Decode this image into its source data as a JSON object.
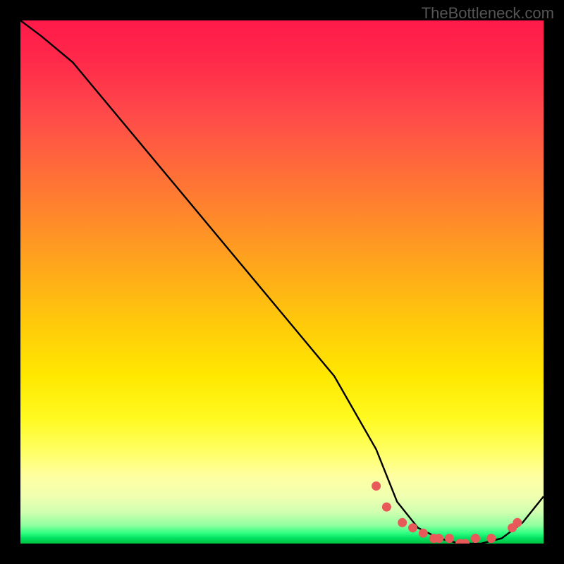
{
  "watermark": "TheBottleneck.com",
  "chart_data": {
    "type": "line",
    "title": "",
    "xlabel": "",
    "ylabel": "",
    "xlim": [
      0,
      100
    ],
    "ylim": [
      0,
      100
    ],
    "series": [
      {
        "name": "bottleneck-curve",
        "x": [
          0,
          4,
          10,
          20,
          30,
          40,
          50,
          60,
          68,
          72,
          76,
          80,
          84,
          88,
          92,
          96,
          100
        ],
        "y": [
          100,
          97,
          92,
          80,
          68,
          56,
          44,
          32,
          18,
          8,
          3,
          1,
          0,
          0,
          1,
          4,
          9
        ]
      }
    ],
    "markers": {
      "name": "data-points",
      "x": [
        68,
        70,
        73,
        75,
        77,
        79,
        80,
        82,
        84,
        85,
        87,
        90,
        94,
        95
      ],
      "y": [
        11,
        7,
        4,
        3,
        2,
        1,
        1,
        1,
        0,
        0,
        1,
        1,
        3,
        4
      ]
    },
    "marker_color": "#e85a5a",
    "gradient_stops": [
      {
        "pos": 0,
        "color": "#ff1a4a"
      },
      {
        "pos": 0.5,
        "color": "#ffca0a"
      },
      {
        "pos": 0.85,
        "color": "#ffff80"
      },
      {
        "pos": 1.0,
        "color": "#00c040"
      }
    ]
  }
}
